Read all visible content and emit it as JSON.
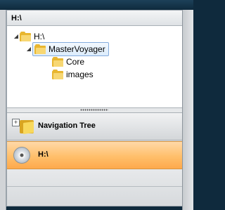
{
  "header": {
    "title": "H:\\"
  },
  "tree": {
    "items": [
      {
        "label": "H:\\",
        "expanded": true,
        "level": 0
      },
      {
        "label": "MasterVoyager",
        "expanded": true,
        "level": 1,
        "selected": true
      },
      {
        "label": "Core",
        "level": 2
      },
      {
        "label": "images",
        "level": 2
      }
    ]
  },
  "nav": {
    "navigation_tree_label": "Navigation Tree",
    "drive_label": "H:\\"
  }
}
